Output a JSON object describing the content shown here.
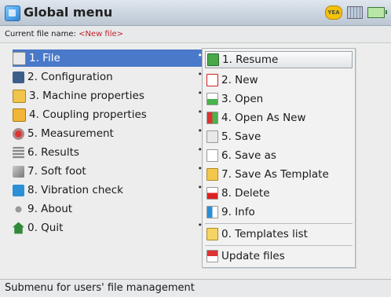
{
  "window": {
    "title": "Global menu"
  },
  "status_icons": {
    "badge": "YEA",
    "signal": "grid-icon",
    "battery": "battery-icon"
  },
  "file": {
    "label": "Current file name:",
    "name": "<New file>"
  },
  "main_menu": [
    {
      "label": "1. File",
      "icon": "file-icon",
      "has_submenu": true
    },
    {
      "label": "2. Configuration",
      "icon": "configuration-icon",
      "has_submenu": true
    },
    {
      "label": "3. Machine properties",
      "icon": "machine-icon",
      "has_submenu": true
    },
    {
      "label": "4. Coupling properties",
      "icon": "coupling-icon",
      "has_submenu": true
    },
    {
      "label": "5. Measurement",
      "icon": "measurement-icon",
      "has_submenu": true
    },
    {
      "label": "6. Results",
      "icon": "results-icon",
      "has_submenu": true
    },
    {
      "label": "7. Soft foot",
      "icon": "soft-foot-icon",
      "has_submenu": true
    },
    {
      "label": "8. Vibration check",
      "icon": "vibration-icon",
      "has_submenu": true
    },
    {
      "label": "9. About",
      "icon": "about-icon",
      "has_submenu": false
    },
    {
      "label": "0. Quit",
      "icon": "quit-icon",
      "has_submenu": true
    }
  ],
  "submenu": [
    {
      "label": "1. Resume",
      "icon": "resume-icon"
    },
    {
      "label": "2. New",
      "icon": "new-file-icon"
    },
    {
      "label": "3. Open",
      "icon": "open-icon"
    },
    {
      "label": "4. Open As New",
      "icon": "open-as-new-icon"
    },
    {
      "label": "5. Save",
      "icon": "save-icon"
    },
    {
      "label": "6. Save as",
      "icon": "save-as-icon"
    },
    {
      "label": "7. Save As Template",
      "icon": "save-template-icon"
    },
    {
      "label": "8. Delete",
      "icon": "delete-icon"
    },
    {
      "label": "9. Info",
      "icon": "info-icon"
    },
    {
      "label": "0. Templates list",
      "icon": "templates-list-icon"
    },
    {
      "label": "Update files",
      "icon": "update-files-icon"
    }
  ],
  "statusbar": {
    "text": "Submenu for users' file management"
  },
  "colors": {
    "selection": "#4a79c9",
    "filename": "#c4222a"
  }
}
